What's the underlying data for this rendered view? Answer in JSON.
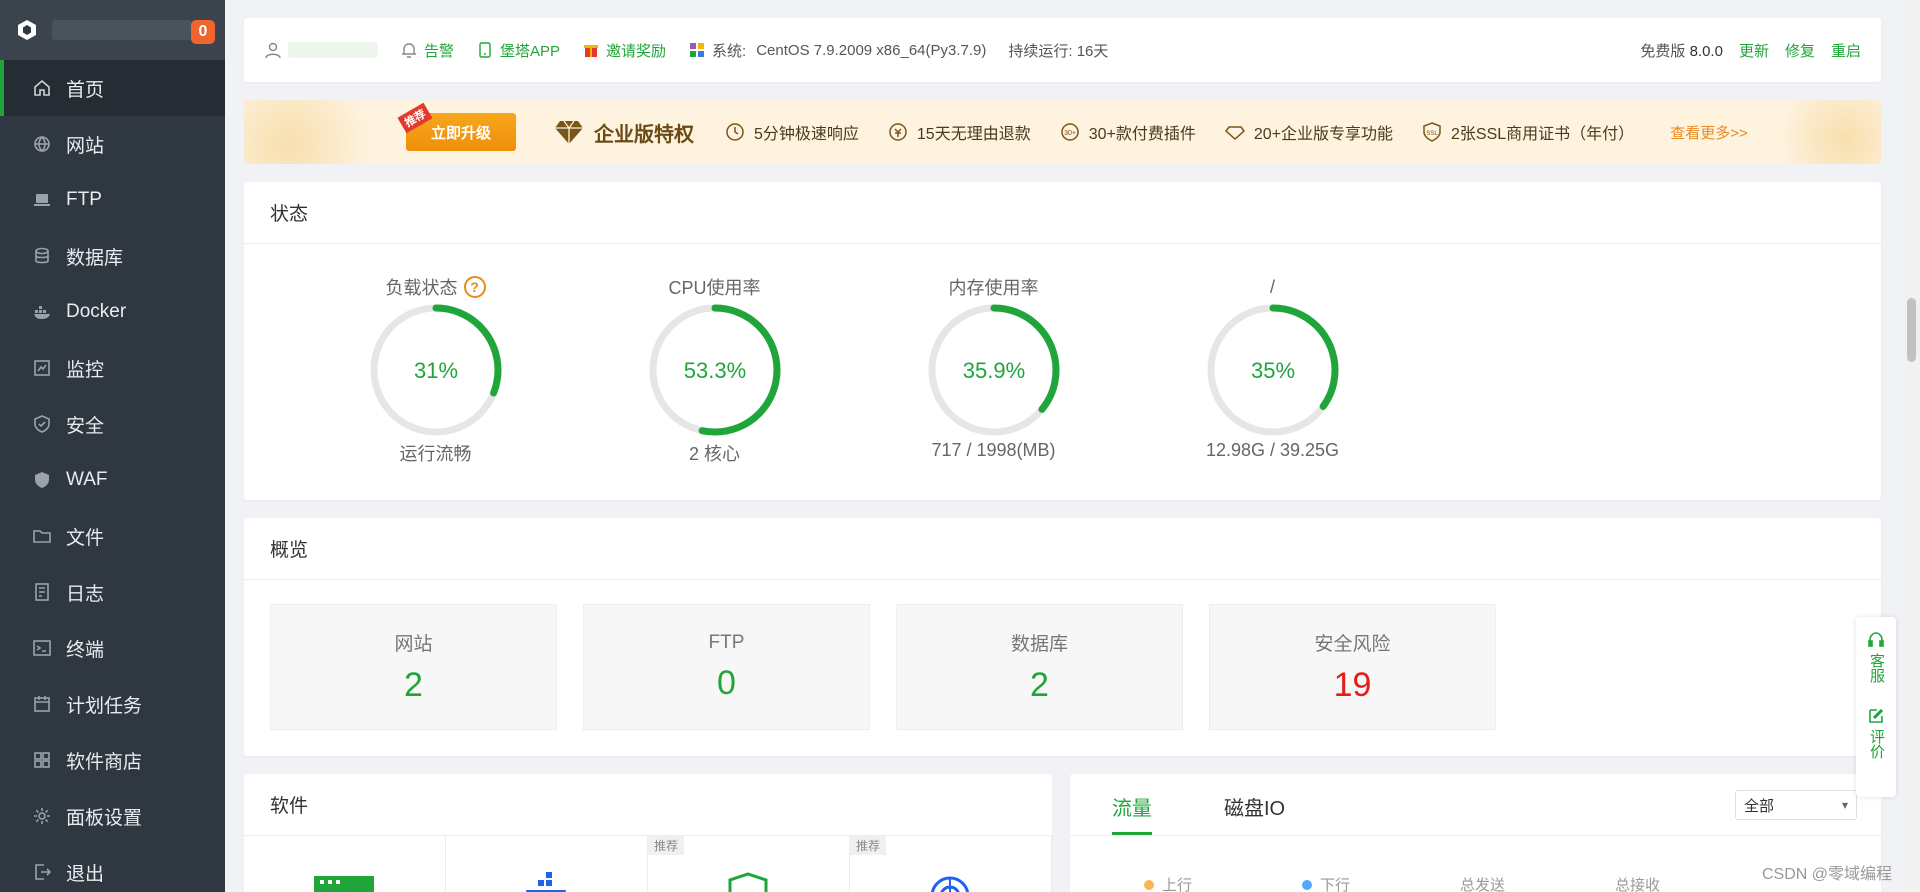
{
  "sidebar": {
    "badge": "0",
    "items": [
      {
        "label": "首页",
        "icon": "home-icon"
      },
      {
        "label": "网站",
        "icon": "globe-icon"
      },
      {
        "label": "FTP",
        "icon": "ftp-icon"
      },
      {
        "label": "数据库",
        "icon": "database-icon"
      },
      {
        "label": "Docker",
        "icon": "docker-icon"
      },
      {
        "label": "监控",
        "icon": "monitor-icon"
      },
      {
        "label": "安全",
        "icon": "shield-icon"
      },
      {
        "label": "WAF",
        "icon": "waf-icon"
      },
      {
        "label": "文件",
        "icon": "folder-icon"
      },
      {
        "label": "日志",
        "icon": "log-icon"
      },
      {
        "label": "终端",
        "icon": "terminal-icon"
      },
      {
        "label": "计划任务",
        "icon": "calendar-icon"
      },
      {
        "label": "软件商店",
        "icon": "apps-icon"
      },
      {
        "label": "面板设置",
        "icon": "gear-icon"
      },
      {
        "label": "退出",
        "icon": "logout-icon"
      }
    ]
  },
  "header": {
    "alert": "告警",
    "app": "堡塔APP",
    "invite": "邀请奖励",
    "system_label": "系统:",
    "system_value": "CentOS 7.9.2009 x86_64(Py3.7.9)",
    "uptime": "持续运行: 16天",
    "version_label": "免费版",
    "version": "8.0.0",
    "update": "更新",
    "repair": "修复",
    "restart": "重启"
  },
  "banner": {
    "tag": "推荐",
    "upgrade": "立即升级",
    "title": "企业版特权",
    "features": [
      "5分钟极速响应",
      "15天无理由退款",
      "30+款付费插件",
      "20+企业版专享功能",
      "2张SSL商用证书（年付）"
    ],
    "more": "查看更多>>"
  },
  "status": {
    "title": "状态",
    "gauges": [
      {
        "label": "负载状态",
        "value": "31%",
        "percent": 31,
        "sub": "运行流畅",
        "help": "?"
      },
      {
        "label": "CPU使用率",
        "value": "53.3%",
        "percent": 53.3,
        "sub": "2 核心"
      },
      {
        "label": "内存使用率",
        "value": "35.9%",
        "percent": 35.9,
        "sub": "717 / 1998(MB)"
      },
      {
        "label": "/",
        "value": "35%",
        "percent": 35,
        "sub": "12.98G / 39.25G"
      }
    ]
  },
  "overview": {
    "title": "概览",
    "items": [
      {
        "label": "网站",
        "value": "2"
      },
      {
        "label": "FTP",
        "value": "0"
      },
      {
        "label": "数据库",
        "value": "2"
      },
      {
        "label": "安全风险",
        "value": "19"
      }
    ]
  },
  "software": {
    "title": "软件",
    "tags": [
      "推荐",
      "推荐"
    ]
  },
  "traffic": {
    "tabs": [
      "流量",
      "磁盘IO"
    ],
    "select": "全部",
    "legend": [
      "上行",
      "下行",
      "总发送",
      "总接收"
    ]
  },
  "float": {
    "service": "客服",
    "review": "评价"
  },
  "watermark": "CSDN @零域编程",
  "colors": {
    "accent": "#20a53a",
    "danger": "#e41d17",
    "warning": "#e9891e",
    "sidebar": "#2f3740"
  }
}
